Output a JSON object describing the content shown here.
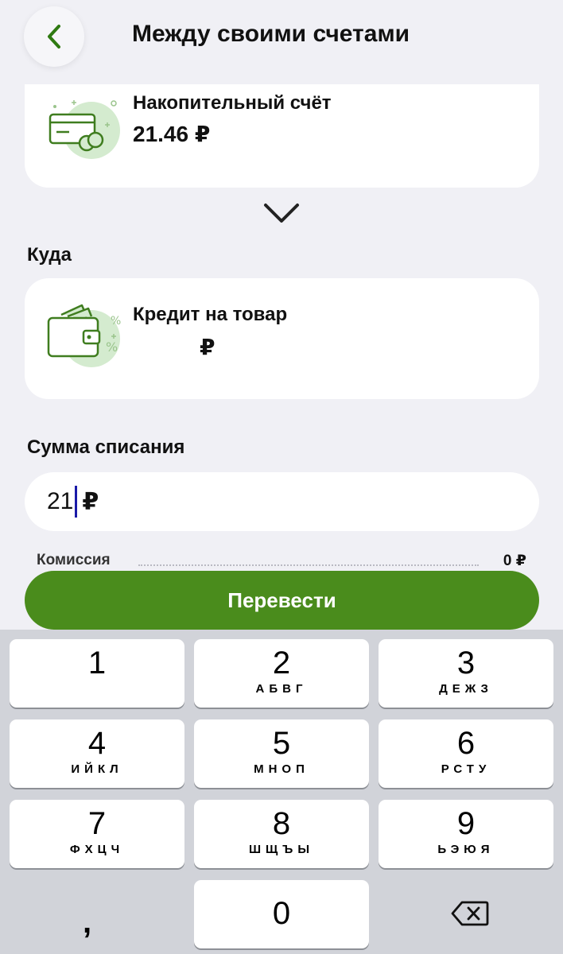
{
  "header": {
    "title": "Между своими счетами",
    "back_icon": "chevron-left-icon"
  },
  "from_account": {
    "name": "Накопительный счёт",
    "amount": "21.46 ₽",
    "icon": "savings-card-icon"
  },
  "swap_icon": "chevron-down-icon",
  "to_section": {
    "label": "Куда",
    "account": {
      "name": "Кредит на товар",
      "amount": "₽",
      "icon": "wallet-percent-icon"
    }
  },
  "amount_section": {
    "label": "Сумма списания",
    "value": "21",
    "currency": "₽"
  },
  "fee": {
    "label": "Комиссия",
    "value": "0 ₽"
  },
  "transfer_button": {
    "label": "Перевести",
    "color": "#4a8c1c"
  },
  "keypad": {
    "keys": [
      {
        "digit": "1",
        "letters": ""
      },
      {
        "digit": "2",
        "letters": "АБВГ"
      },
      {
        "digit": "3",
        "letters": "ДЕЖЗ"
      },
      {
        "digit": "4",
        "letters": "ИЙКЛ"
      },
      {
        "digit": "5",
        "letters": "МНОП"
      },
      {
        "digit": "6",
        "letters": "РСТУ"
      },
      {
        "digit": "7",
        "letters": "ФХЦЧ"
      },
      {
        "digit": "8",
        "letters": "ШЩЪЫ"
      },
      {
        "digit": "9",
        "letters": "ЬЭЮЯ"
      },
      {
        "digit": "0",
        "letters": ""
      }
    ],
    "comma": ",",
    "backspace_icon": "backspace-icon"
  },
  "colors": {
    "background": "#f0f0f5",
    "accent_green": "#4a8c1c",
    "keypad_background": "#d1d3d9"
  }
}
